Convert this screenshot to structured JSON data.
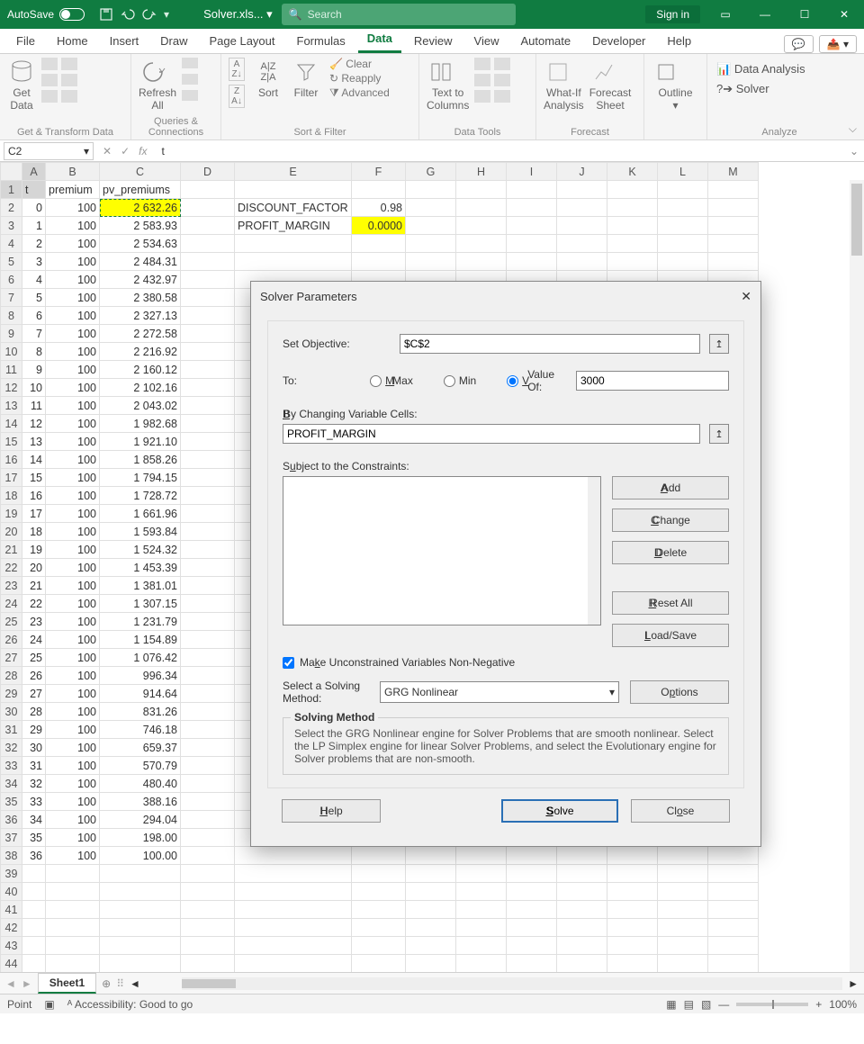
{
  "title": {
    "autosave": "AutoSave",
    "filename": "Solver.xls...",
    "search_ph": "Search",
    "signin": "Sign in"
  },
  "tabs": {
    "items": [
      "File",
      "Home",
      "Insert",
      "Draw",
      "Page Layout",
      "Formulas",
      "Data",
      "Review",
      "View",
      "Automate",
      "Developer",
      "Help"
    ],
    "active": "Data"
  },
  "ribbon": {
    "groups": {
      "g1": "Get & Transform Data",
      "g1_getdata": "Get\nData",
      "g2": "Queries & Connections",
      "g2_refresh": "Refresh\nAll",
      "g3": "Sort & Filter",
      "g3_sort": "Sort",
      "g3_filter": "Filter",
      "g3_clear": "Clear",
      "g3_reapply": "Reapply",
      "g3_advanced": "Advanced",
      "g4": "Data Tools",
      "g4_text": "Text to\nColumns",
      "g5": "Forecast",
      "g5_whatif": "What-If\nAnalysis",
      "g5_forecast": "Forecast\nSheet",
      "g6": "Outline",
      "g6_outline": "Outline",
      "g7": "Analyze",
      "g7_da": "Data Analysis",
      "g7_solver": "Solver"
    }
  },
  "fbar": {
    "namebox": "C2",
    "fx": "fx",
    "formula": "t"
  },
  "columns": [
    "A",
    "B",
    "C",
    "D",
    "E",
    "F",
    "G",
    "H",
    "I",
    "J",
    "K",
    "L",
    "M"
  ],
  "headers": {
    "A": "t",
    "B": "premium",
    "C": "pv_premiums",
    "E1": "DISCOUNT_FACTOR",
    "E2": "PROFIT_MARGIN",
    "F1": "0.98",
    "F2": "0.0000"
  },
  "rows": [
    {
      "t": 0,
      "b": 100,
      "c": "2 632.26"
    },
    {
      "t": 1,
      "b": 100,
      "c": "2 583.93"
    },
    {
      "t": 2,
      "b": 100,
      "c": "2 534.63"
    },
    {
      "t": 3,
      "b": 100,
      "c": "2 484.31"
    },
    {
      "t": 4,
      "b": 100,
      "c": "2 432.97"
    },
    {
      "t": 5,
      "b": 100,
      "c": "2 380.58"
    },
    {
      "t": 6,
      "b": 100,
      "c": "2 327.13"
    },
    {
      "t": 7,
      "b": 100,
      "c": "2 272.58"
    },
    {
      "t": 8,
      "b": 100,
      "c": "2 216.92"
    },
    {
      "t": 9,
      "b": 100,
      "c": "2 160.12"
    },
    {
      "t": 10,
      "b": 100,
      "c": "2 102.16"
    },
    {
      "t": 11,
      "b": 100,
      "c": "2 043.02"
    },
    {
      "t": 12,
      "b": 100,
      "c": "1 982.68"
    },
    {
      "t": 13,
      "b": 100,
      "c": "1 921.10"
    },
    {
      "t": 14,
      "b": 100,
      "c": "1 858.26"
    },
    {
      "t": 15,
      "b": 100,
      "c": "1 794.15"
    },
    {
      "t": 16,
      "b": 100,
      "c": "1 728.72"
    },
    {
      "t": 17,
      "b": 100,
      "c": "1 661.96"
    },
    {
      "t": 18,
      "b": 100,
      "c": "1 593.84"
    },
    {
      "t": 19,
      "b": 100,
      "c": "1 524.32"
    },
    {
      "t": 20,
      "b": 100,
      "c": "1 453.39"
    },
    {
      "t": 21,
      "b": 100,
      "c": "1 381.01"
    },
    {
      "t": 22,
      "b": 100,
      "c": "1 307.15"
    },
    {
      "t": 23,
      "b": 100,
      "c": "1 231.79"
    },
    {
      "t": 24,
      "b": 100,
      "c": "1 154.89"
    },
    {
      "t": 25,
      "b": 100,
      "c": "1 076.42"
    },
    {
      "t": 26,
      "b": 100,
      "c": "996.34"
    },
    {
      "t": 27,
      "b": 100,
      "c": "914.64"
    },
    {
      "t": 28,
      "b": 100,
      "c": "831.26"
    },
    {
      "t": 29,
      "b": 100,
      "c": "746.18"
    },
    {
      "t": 30,
      "b": 100,
      "c": "659.37"
    },
    {
      "t": 31,
      "b": 100,
      "c": "570.79"
    },
    {
      "t": 32,
      "b": 100,
      "c": "480.40"
    },
    {
      "t": 33,
      "b": 100,
      "c": "388.16"
    },
    {
      "t": 34,
      "b": 100,
      "c": "294.04"
    },
    {
      "t": 35,
      "b": 100,
      "c": "198.00"
    },
    {
      "t": 36,
      "b": 100,
      "c": "100.00"
    }
  ],
  "sheet": {
    "name": "Sheet1"
  },
  "status": {
    "mode": "Point",
    "acc": "Accessibility: Good to go",
    "zoom": "100%"
  },
  "solver": {
    "title": "Solver Parameters",
    "set_obj_label": "Set Objective:",
    "set_obj": "$C$2",
    "to_label": "To:",
    "max": "Max",
    "min": "Min",
    "valueof": "Value Of:",
    "valueof_val": "3000",
    "bychanging_label": "By Changing Variable Cells:",
    "bychanging": "PROFIT_MARGIN",
    "constraints_label": "Subject to the Constraints:",
    "add": "Add",
    "change": "Change",
    "delete": "Delete",
    "resetall": "Reset All",
    "loadsave": "Load/Save",
    "nonneg": "Make Unconstrained Variables Non-Negative",
    "method_label": "Select a Solving\nMethod:",
    "method": "GRG Nonlinear",
    "options": "Options",
    "sm_title": "Solving Method",
    "sm_text": "Select the GRG Nonlinear engine for Solver Problems that are smooth nonlinear. Select the LP Simplex engine for linear Solver Problems, and select the Evolutionary engine for Solver problems that are non-smooth.",
    "help": "Help",
    "solve": "Solve",
    "close": "Close"
  }
}
